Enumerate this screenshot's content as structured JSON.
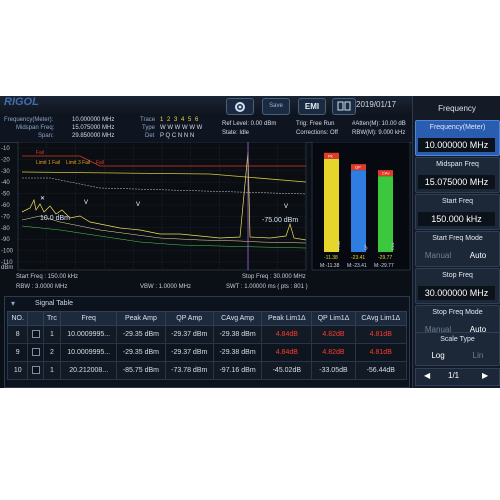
{
  "top": {
    "logo": "RIGOL",
    "icon1": "",
    "icon2": "Save",
    "icon3": "EMI",
    "icon4": "",
    "date": "2019/01/17"
  },
  "info": {
    "freq_meter_label": "Frequency(Meter):",
    "freq_meter_value": "10.000000 MHz",
    "midspan_label": "Midspan Freq:",
    "midspan_value": "15.075000 MHz",
    "span_label": "Span:",
    "span_value": "29.850000 MHz",
    "trace_label": "Trace",
    "trace_dots": "1 2 3 4 5 6",
    "type_label": "Type",
    "type_value": "W W W W W W",
    "det_label": "Det",
    "det_value": "P Q C N N N",
    "ref_level": "Ref Level: 0.00 dBm",
    "state": "State: Idle",
    "trig": "Trig: Free Run",
    "corrections": "Corrections: Off",
    "atten": "#Atten(M): 10.00 dB",
    "rbw": "RBW(M): 9.000 kHz"
  },
  "plot": {
    "y_unit": "dBm",
    "y_ticks": [
      "-10",
      "-20",
      "-30",
      "-40",
      "-50",
      "-60",
      "-70",
      "-80",
      "-90",
      "-100",
      "-110"
    ],
    "limit_labels": [
      "Fail",
      "Limit 1 Fail",
      "Limit 3 Fail",
      "Fail"
    ],
    "marker_readout_left": "10.0 dBm",
    "marker_readout_right": "-75.00 dBm",
    "bar_top_labels": [
      "Pk",
      "QP",
      "CAv"
    ],
    "bar_side_labels": [
      "Peak",
      "QP",
      "CAv"
    ],
    "bar_values": [
      "-11.38",
      "-23.41",
      "-29.77"
    ],
    "bar_m_values": [
      "M:-11.38",
      "M:-23.41",
      "M:-29.77"
    ],
    "bar_colors": [
      "#e6d52a",
      "#2f7de0",
      "#3cc83c"
    ],
    "bar_levels": [
      -11.38,
      -23.41,
      -29.77
    ]
  },
  "freqbar": {
    "start": "Start Freq : 150.00 kHz",
    "rbw": "RBW : 3.0000 MHz",
    "vbw": "VBW : 1.0000 MHz",
    "stop": "Stop Freq : 30.000 MHz",
    "swt": "SWT : 1.00000 ms ( pts : 801 )"
  },
  "signal_table": {
    "title": "Signal Table",
    "columns": [
      "NO.",
      "",
      "Trc",
      "Freq",
      "Peak Amp",
      "QP Amp",
      "CAvg Amp",
      "Peak Lim1Δ",
      "QP Lim1Δ",
      "CAvg Lim1Δ"
    ],
    "rows": [
      {
        "no": "8",
        "trc": "1",
        "freq": "10.0009995...",
        "peak": "-29.35 dBm",
        "qp": "-29.37 dBm",
        "cavg": "-29.38 dBm",
        "peak_lim": "4.84dB",
        "qp_lim": "4.82dB",
        "cavg_lim": "4.81dB"
      },
      {
        "no": "9",
        "trc": "2",
        "freq": "10.0009995...",
        "peak": "-29.35 dBm",
        "qp": "-29.37 dBm",
        "cavg": "-29.38 dBm",
        "peak_lim": "4.84dB",
        "qp_lim": "4.82dB",
        "cavg_lim": "4.81dB"
      },
      {
        "no": "10",
        "trc": "1",
        "freq": "20.212008...",
        "peak": "-85.75 dBm",
        "qp": "-73.78 dBm",
        "cavg": "-97.16 dBm",
        "peak_lim": "-45.02dB",
        "qp_lim": "-33.05dB",
        "cavg_lim": "-56.44dB"
      }
    ]
  },
  "right_panel": {
    "header": "Frequency",
    "freq_meter_label": "Frequency(Meter)",
    "freq_meter_value": "10.000000 MHz",
    "midspan_label": "Midspan Freq",
    "midspan_value": "15.075000 MHz",
    "start_label": "Start Freq",
    "start_value": "150.000 kHz",
    "start_mode_label": "Start Freq Mode",
    "start_mode_manual": "Manual",
    "start_mode_auto": "Auto",
    "stop_label": "Stop Freq",
    "stop_value": "30.000000 MHz",
    "stop_mode_label": "Stop Freq Mode",
    "stop_mode_manual": "Manual",
    "stop_mode_auto": "Auto",
    "scale_label": "Scale Type",
    "scale_log": "Log",
    "scale_lin": "Lin",
    "page": "1/1"
  }
}
